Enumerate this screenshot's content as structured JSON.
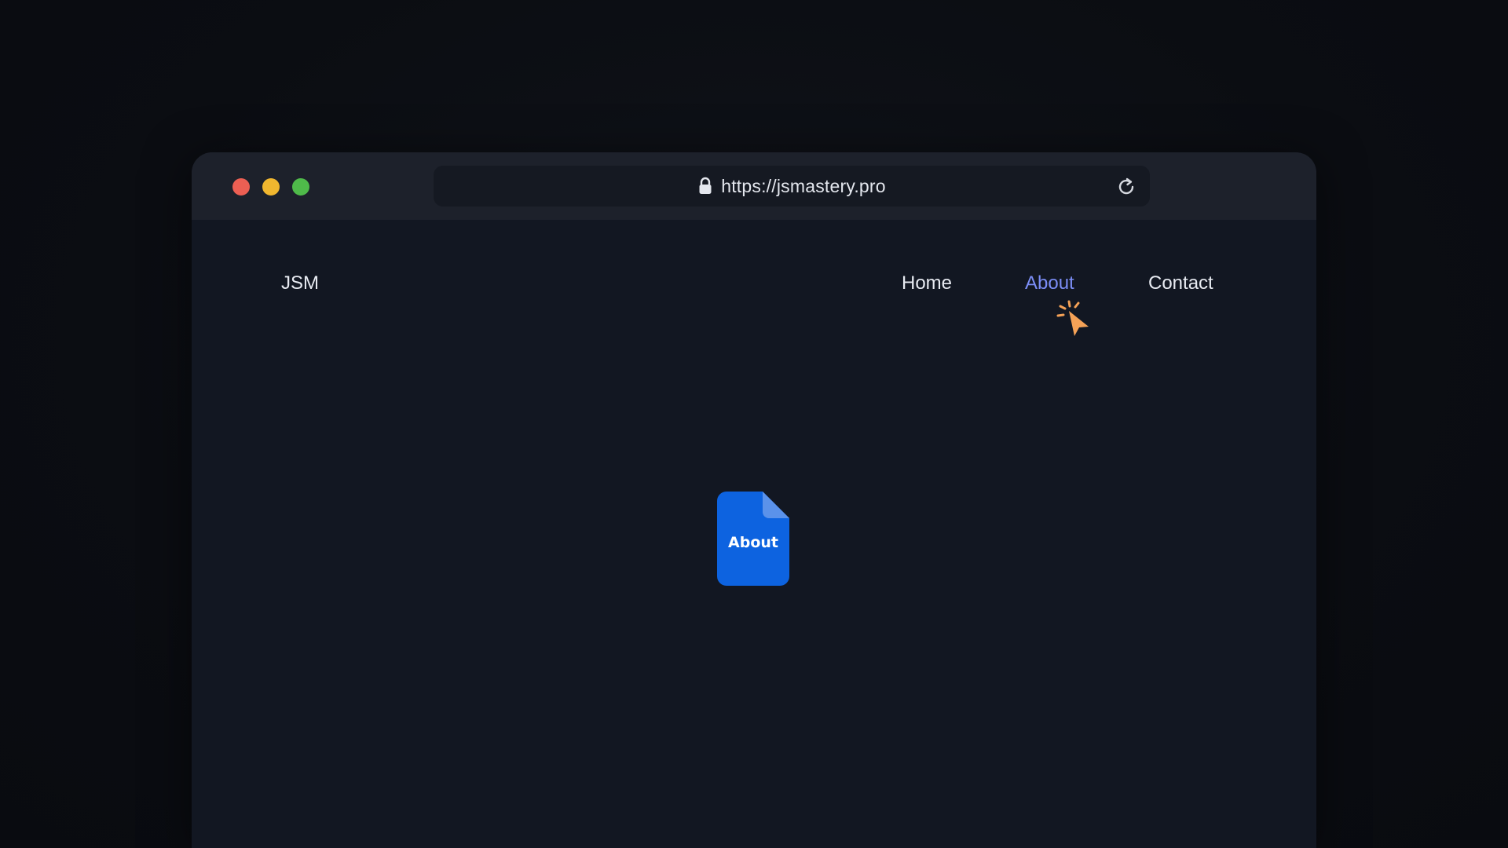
{
  "browser": {
    "url": "https://jsmastery.pro",
    "icons": {
      "lock": "lock-icon",
      "reload": "reload-icon"
    },
    "window_controls": {
      "close_color": "#ec5f53",
      "minimize_color": "#f1b72f",
      "maximize_color": "#4fba4a"
    }
  },
  "page": {
    "logo": "JSM",
    "nav": {
      "home": "Home",
      "about": "About",
      "contact": "Contact",
      "active": "About",
      "active_color": "#7b8df5"
    },
    "file": {
      "label": "About",
      "icon": "document-icon",
      "color": "#0d63e0"
    },
    "cursor": {
      "icon": "click-cursor-icon",
      "color": "#f5a257"
    }
  }
}
